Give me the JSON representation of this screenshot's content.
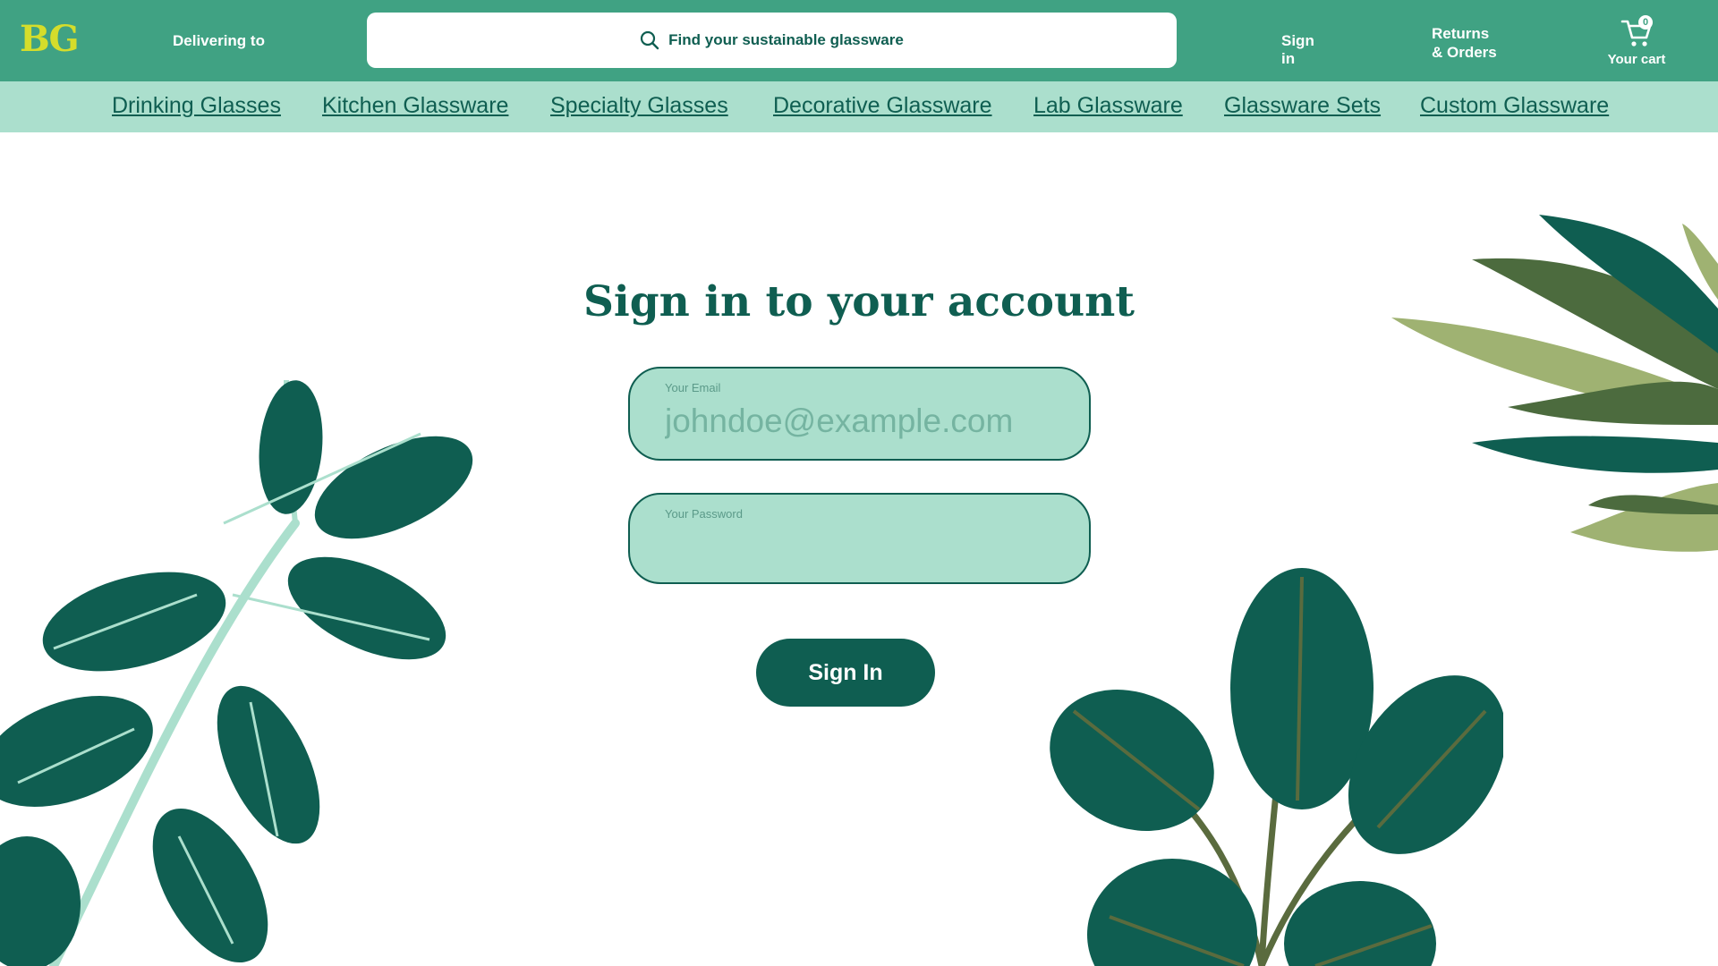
{
  "header": {
    "logo": "BG",
    "delivering": "Delivering to",
    "search_placeholder": "Find your sustainable glassware",
    "sign_in": "Sign in",
    "returns_line1": "Returns",
    "returns_line2": "& Orders",
    "cart_count": "0",
    "cart_label": "Your cart"
  },
  "categories": [
    "Drinking Glasses",
    "Kitchen Glassware",
    "Specialty Glasses",
    "Decorative Glassware",
    "Lab Glassware",
    "Glassware Sets",
    "Custom Glassware"
  ],
  "form": {
    "title": "Sign in to your account",
    "email_label": "Your Email",
    "email_placeholder": "johndoe@example.com",
    "password_label": "Your Password",
    "password_placeholder": "",
    "submit": "Sign In"
  },
  "colors": {
    "header": "#40a283",
    "category_bar": "#abdfcd",
    "primary": "#0f5e51",
    "logo": "#d5dd2b"
  }
}
